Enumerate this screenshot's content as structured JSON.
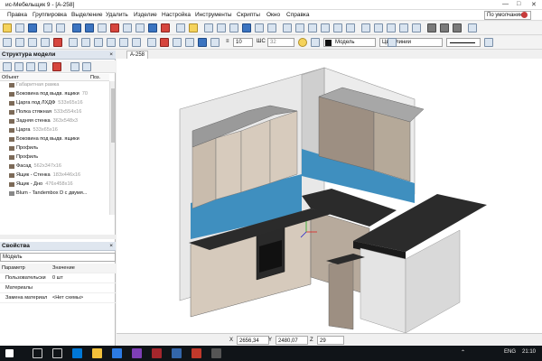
{
  "window": {
    "title": "ис-Мебельщик 9 - [A-258]"
  },
  "menu": {
    "items": [
      "Правка",
      "Группировка",
      "Выделение",
      "Удалить",
      "Изделие",
      "Настройка",
      "Инструменты",
      "Скрипты",
      "Окно",
      "Справка"
    ],
    "mode_select": "По умолчанию"
  },
  "toolbar2": {
    "line_width": "10",
    "step_label": "ШС",
    "step_value": "32",
    "material": "Модель",
    "line_color_label": "Цвет линии"
  },
  "doc_tab": "A-258",
  "model_panel": {
    "title": "Структура модели",
    "columns": {
      "object": "Объект",
      "pos": "Поз."
    },
    "tree": [
      {
        "name": "Габаритная рамка",
        "dim": "",
        "gray": true
      },
      {
        "name": "Боковина под выдв. ящики",
        "dim": "70",
        "gray": false
      },
      {
        "name": "Царга под ЛХДФ",
        "dim": "533x65x16",
        "gray": false
      },
      {
        "name": "Полка стяжная",
        "dim": "533x554x16",
        "gray": false
      },
      {
        "name": "Задняя стенка",
        "dim": "363x548x3",
        "gray": false
      },
      {
        "name": "Царга",
        "dim": "533x65x16",
        "gray": false
      },
      {
        "name": "Боковина под выдв. ящики",
        "dim": "",
        "gray": false
      },
      {
        "name": "Профиль",
        "dim": "",
        "gray": false
      },
      {
        "name": "Профиль",
        "dim": "",
        "gray": false
      },
      {
        "name": "Фасад",
        "dim": "562x347x16",
        "gray": false
      },
      {
        "name": "Ящик - Стенка",
        "dim": "183x446x16",
        "gray": false
      },
      {
        "name": "Ящик - Дно",
        "dim": "476x458x16",
        "gray": false
      },
      {
        "name": "Blum - Tandembox D с двумя...",
        "dim": "",
        "gray": false
      }
    ]
  },
  "properties_panel": {
    "title": "Свойства",
    "selector": "Модель",
    "columns": {
      "param": "Параметр",
      "value": "Значение"
    },
    "rows": [
      {
        "param": "Пользовательски",
        "value": "0 шт"
      },
      {
        "param": "Материалы",
        "value": ""
      },
      {
        "param": "Замена материал",
        "value": "<Нет схемы>"
      }
    ]
  },
  "status": {
    "x_label": "X",
    "x": "2656,34",
    "y_label": "Y",
    "y": "2480,07",
    "z_label": "Z",
    "z": "29"
  },
  "taskbar": {
    "lang": "ENG",
    "time": "21:10"
  },
  "colors": {
    "worktop": "#2b2b2b",
    "backsplash": "#3f8fbf",
    "facade_light": "#d7cbbd",
    "facade_dark": "#9d8f82"
  }
}
